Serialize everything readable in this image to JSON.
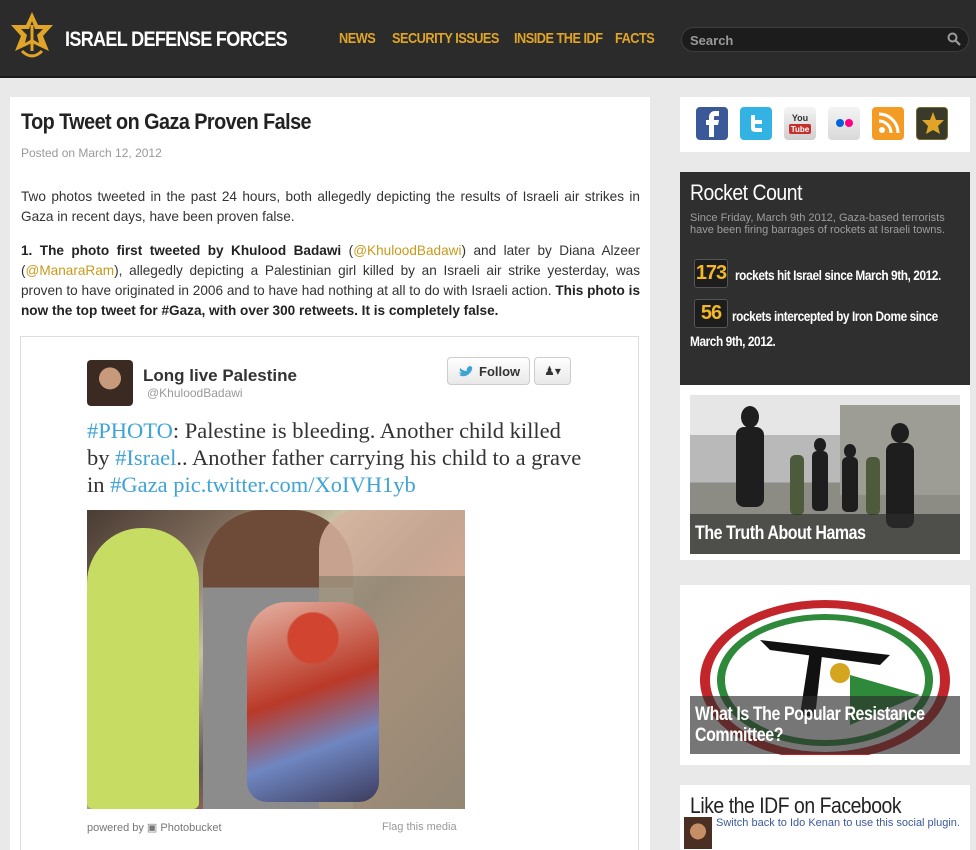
{
  "header": {
    "site_title": "ISRAEL DEFENSE FORCES",
    "nav": [
      "NEWS",
      "SECURITY ISSUES",
      "INSIDE THE IDF",
      "FACTS"
    ],
    "search_placeholder": "Search"
  },
  "article": {
    "title": "Top Tweet on Gaza Proven False",
    "posted_on": "Posted on March 12, 2012",
    "paragraph1": "Two photos tweeted in the past 24 hours, both allegedly depicting the results of Israeli air strikes in Gaza in recent days, have been proven false.",
    "p2_bold1": "1. The photo first tweeted by Khulood Badawi",
    "p2_open": " (",
    "p2_link1": "@KhuloodBadawi",
    "p2_mid1": ") and later by Diana Alzeer (",
    "p2_link2": "@ManaraRam",
    "p2_mid2": "), allegedly depicting a Palestinian girl killed by an Israeli air strike yesterday, was proven to have originated in 2006 and to have had nothing at all to do with Israeli action. ",
    "p2_bold2": "This photo is now the top tweet for #Gaza, with over 300 retweets. It is completely false."
  },
  "tweet": {
    "name": "Long live Palestine",
    "handle": "@KhuloodBadawi",
    "follow_label": "Follow",
    "user_menu_label": "▾",
    "text_tag1": "#PHOTO",
    "text_1": ": Palestine is bleeding. Another child killed by ",
    "text_tag2": "#Israel",
    "text_2": ".. Another father carrying his child to a grave in ",
    "text_tag3": "#Gaza",
    "text_3": " ",
    "text_link": "pic.twitter.com/XoIVH1yb",
    "powered_by": "powered by ▣ Photobucket",
    "flag": "Flag this media"
  },
  "sidebar": {
    "social_icons": [
      "facebook-icon",
      "twitter-icon",
      "youtube-icon",
      "flickr-icon",
      "rss-icon",
      "idf-icon"
    ],
    "rocket": {
      "title": "Rocket Count",
      "subtitle": "Since Friday, March 9th 2012, Gaza-based terrorists have been firing barrages of rockets at Israeli towns.",
      "count1": "173",
      "text1": "rockets hit Israel since March 9th, 2012.",
      "count2": "56",
      "text2a": "rockets intercepted by Iron Dome since",
      "text2b": "March 9th, 2012."
    },
    "promo1": "The Truth About Hamas",
    "promo2_line1": "What Is The Popular Resistance",
    "promo2_line2": "Committee?",
    "facebook_title": "Like the IDF on Facebook",
    "facebook_text": "Switch back to Ido Kenan to use this social plugin."
  },
  "colors": {
    "accent": "#e0a526",
    "link": "#c9991c",
    "tweet_hashtag": "#3fa3d6"
  }
}
